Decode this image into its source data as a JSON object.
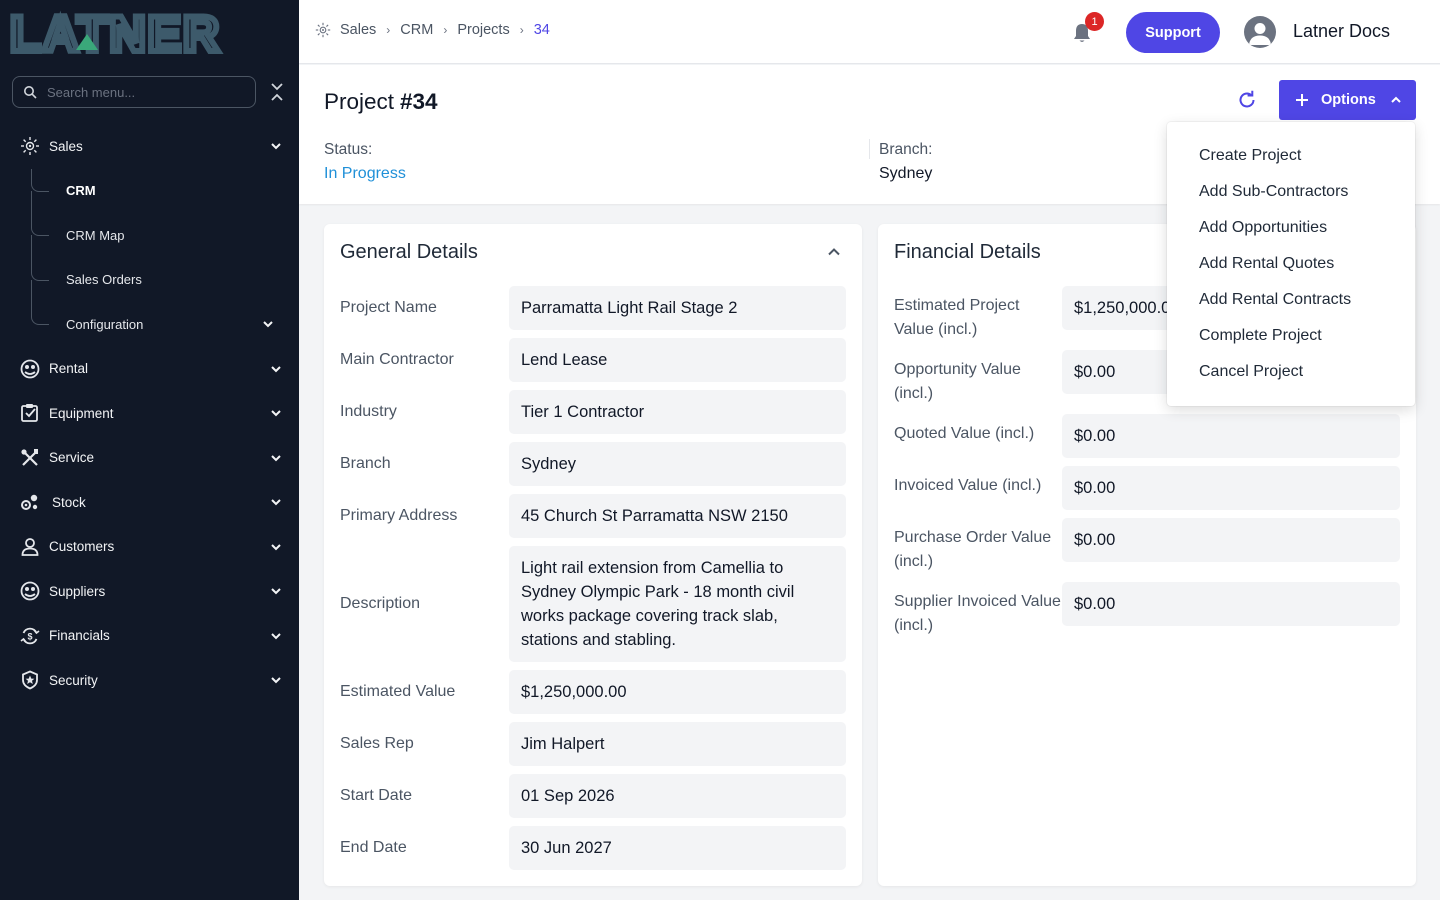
{
  "brand": {
    "logo_text": "LATNER"
  },
  "sidebar": {
    "search_placeholder": "Search menu...",
    "items": [
      {
        "label": "Sales",
        "icon": "sales-icon",
        "expanded": true,
        "children": [
          {
            "label": "CRM",
            "active": true
          },
          {
            "label": "CRM Map"
          },
          {
            "label": "Sales Orders"
          },
          {
            "label": "Configuration",
            "has_children": true
          }
        ]
      },
      {
        "label": "Rental",
        "icon": "rental-icon"
      },
      {
        "label": "Equipment",
        "icon": "equipment-icon"
      },
      {
        "label": "Service",
        "icon": "service-icon"
      },
      {
        "label": "Stock",
        "icon": "stock-icon"
      },
      {
        "label": "Customers",
        "icon": "customers-icon"
      },
      {
        "label": "Suppliers",
        "icon": "suppliers-icon"
      },
      {
        "label": "Financials",
        "icon": "financials-icon"
      },
      {
        "label": "Security",
        "icon": "security-icon"
      }
    ]
  },
  "topbar": {
    "breadcrumb": [
      "Sales",
      "CRM",
      "Projects",
      "34"
    ],
    "notification_count": "1",
    "support_label": "Support",
    "user_name": "Latner Docs"
  },
  "page": {
    "title": "Project",
    "number": "#34",
    "status_label": "Status:",
    "status_value": "In Progress",
    "branch_label": "Branch:",
    "branch_value": "Sydney",
    "options_label": "Options"
  },
  "options_menu": [
    "Create Project",
    "Add Sub-Contractors",
    "Add Opportunities",
    "Add Rental Quotes",
    "Add Rental Contracts",
    "Complete Project",
    "Cancel Project"
  ],
  "general": {
    "title": "General Details",
    "fields": [
      {
        "label": "Project Name",
        "value": "Parramatta Light Rail Stage 2"
      },
      {
        "label": "Main Contractor",
        "value": "Lend Lease"
      },
      {
        "label": "Industry",
        "value": "Tier 1 Contractor"
      },
      {
        "label": "Branch",
        "value": "Sydney"
      },
      {
        "label": "Primary Address",
        "value": "45 Church St Parramatta NSW 2150"
      },
      {
        "label": "Description",
        "value": "Light rail extension from Camellia to Sydney Olympic Park - 18 month civil works package covering track slab, stations and stabling."
      },
      {
        "label": "Estimated Value",
        "value": "$1,250,000.00"
      },
      {
        "label": "Sales Rep",
        "value": "Jim Halpert"
      },
      {
        "label": "Start Date",
        "value": "01 Sep 2026"
      },
      {
        "label": "End Date",
        "value": "30 Jun 2027"
      }
    ]
  },
  "financial": {
    "title": "Financial Details",
    "fields": [
      {
        "label": "Estimated Project Value (incl.)",
        "value": "$1,250,000.00"
      },
      {
        "label": "Opportunity Value (incl.)",
        "value": "$0.00"
      },
      {
        "label": "Quoted Value (incl.)",
        "value": "$0.00"
      },
      {
        "label": "Invoiced Value (incl.)",
        "value": "$0.00"
      },
      {
        "label": "Purchase Order Value (incl.)",
        "value": "$0.00"
      },
      {
        "label": "Supplier Invoiced Value (incl.)",
        "value": "$0.00"
      }
    ]
  },
  "colors": {
    "sidebar_bg": "#111827",
    "accent": "#4f46e5",
    "status_in_progress": "#2090d8",
    "badge": "#dc2626",
    "logo": "#3d5a6b",
    "logo_accent": "#3aa87a"
  }
}
